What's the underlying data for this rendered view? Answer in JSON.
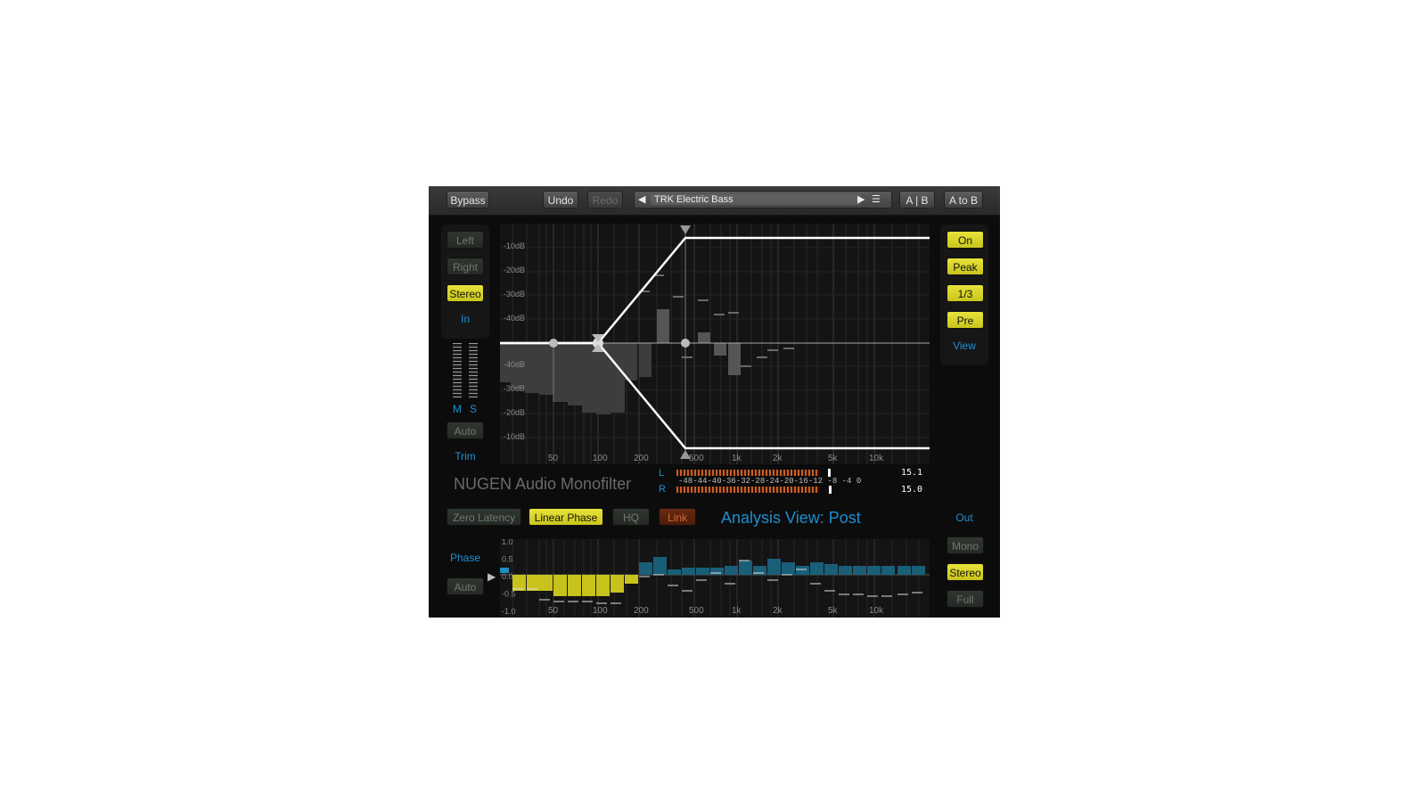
{
  "toolbar": {
    "bypass": "Bypass",
    "undo": "Undo",
    "redo": "Redo",
    "preset_name": "TRK Electric Bass",
    "ab": "A | B",
    "a_to_b": "A to B"
  },
  "input_panel": {
    "left": "Left",
    "right": "Right",
    "stereo": "Stereo",
    "in": "In",
    "m": "M",
    "s": "S",
    "auto": "Auto",
    "trim": "Trim"
  },
  "view_panel": {
    "on": "On",
    "peak": "Peak",
    "third": "1/3",
    "pre": "Pre",
    "view": "View"
  },
  "output_panel": {
    "out": "Out",
    "mono": "Mono",
    "stereo": "Stereo",
    "full": "Full"
  },
  "phase_panel": {
    "phase": "Phase",
    "auto": "Auto"
  },
  "brand": "NUGEN Audio Monofilter",
  "options": {
    "zero_latency": "Zero Latency",
    "linear_phase": "Linear Phase",
    "hq": "HQ",
    "link": "Link"
  },
  "analysis_view": "Analysis View: Post",
  "meter": {
    "l": "L",
    "r": "R",
    "scale": "-48-44-40-36-32-28-24-20-16-12 -8  -4  0",
    "l_value": "15.1",
    "r_value": "15.0"
  },
  "colors": {
    "accent_yellow": "#dcd82c",
    "accent_blue": "#1e8fd0",
    "link_red": "#6a2a12",
    "phase_yellow": "#c8c31c",
    "phase_blue": "#1a5f78"
  },
  "graph": {
    "db_labels_top": [
      "-10dB",
      "-20dB",
      "-30dB",
      "-40dB"
    ],
    "db_labels_bottom": [
      "-40dB",
      "-30dB",
      "-20dB",
      "-10dB"
    ],
    "freq_labels": [
      "50",
      "100",
      "200",
      "500",
      "1k",
      "2k",
      "5k",
      "10k"
    ]
  },
  "phase_graph": {
    "y_labels": [
      "1.0",
      "0.5",
      "0.0",
      "-0.5",
      "-1.0"
    ],
    "freq_labels": [
      "50",
      "100",
      "200",
      "500",
      "1k",
      "2k",
      "5k",
      "10k"
    ]
  }
}
